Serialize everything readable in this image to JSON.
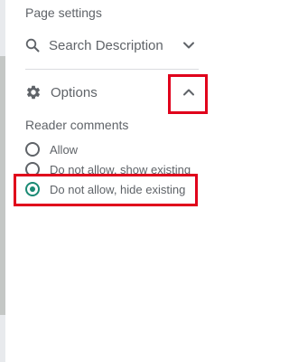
{
  "panel": {
    "title": "Page settings"
  },
  "search": {
    "label": "Search Description"
  },
  "options": {
    "label": "Options"
  },
  "reader_comments": {
    "title": "Reader comments",
    "choices": [
      {
        "label": "Allow",
        "selected": false
      },
      {
        "label": "Do not allow, show existing",
        "selected": false
      },
      {
        "label": "Do not allow, hide existing",
        "selected": true
      }
    ]
  },
  "colors": {
    "accent": "#1a8a74",
    "highlight": "#e0001b",
    "text": "#5f6368"
  },
  "icons": [
    "search-icon",
    "chevron-down-icon",
    "gear-icon",
    "chevron-up-icon"
  ]
}
